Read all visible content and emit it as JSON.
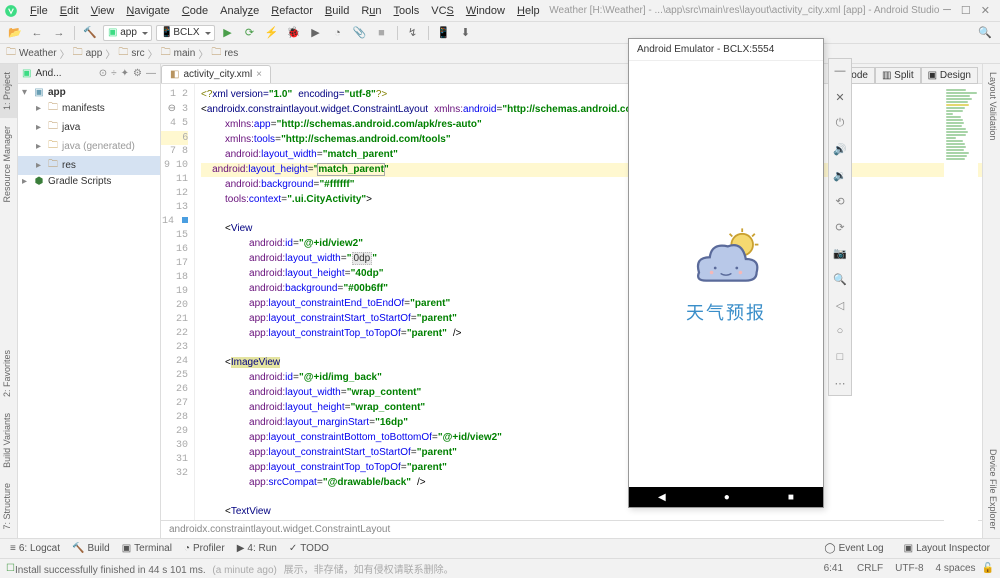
{
  "menubar": {
    "items": [
      "File",
      "Edit",
      "View",
      "Navigate",
      "Code",
      "Analyze",
      "Refactor",
      "Build",
      "Run",
      "Tools",
      "VCS",
      "Window",
      "Help"
    ],
    "title": "Weather [H:\\Weather] - ...\\app\\src\\main\\res\\layout\\activity_city.xml [app] - Android Studio"
  },
  "toolbar": {
    "config1": "app",
    "config2": "BCLX"
  },
  "breadcrumb": {
    "items": [
      "Weather",
      "app",
      "src",
      "main",
      "res"
    ]
  },
  "project": {
    "tab_label": "And...",
    "tree": {
      "root": "app",
      "items": [
        {
          "label": "manifests",
          "indent": 1
        },
        {
          "label": "java",
          "indent": 1
        },
        {
          "label": "java (generated)",
          "indent": 1,
          "gen": true
        },
        {
          "label": "res",
          "indent": 1,
          "sel": true
        },
        {
          "label": "Gradle Scripts",
          "indent": 0
        }
      ]
    }
  },
  "left_tabs": [
    "1: Project",
    "Resource Manager",
    "2: Favorites",
    "Build Variants",
    "7: Structure"
  ],
  "right_tabs": [
    "Layout Validation",
    "Device File Explorer"
  ],
  "editor": {
    "tab": "activity_city.xml",
    "status": "androidx.constraintlayout.widget.ConstraintLayout",
    "lines": [
      1,
      2,
      3,
      4,
      5,
      6,
      7,
      8,
      9,
      10,
      11,
      12,
      13,
      14,
      15,
      16,
      17,
      18,
      19,
      20,
      21,
      22,
      23,
      24,
      25,
      26,
      27,
      28,
      29,
      30,
      31,
      32
    ]
  },
  "view_buttons": [
    "Code",
    "Split",
    "Design"
  ],
  "emulator": {
    "title": "Android Emulator - BCLX:5554",
    "label": "天气预报"
  },
  "bottom": {
    "tabs": [
      "6: Logcat",
      "Build",
      "Terminal",
      "Profiler",
      "4: Run",
      "TODO"
    ],
    "right": [
      "Event Log",
      "Layout Inspector"
    ]
  },
  "statusbar": {
    "msg": "Install successfully finished in 44 s 101 ms.",
    "sub": "(a minute ago)",
    "chinese": "展示，非存储，如有侵权请联系删除。",
    "pos": "6:41",
    "enc": "CRLF",
    "enc2": "UTF-8",
    "spaces": "4 spaces"
  }
}
